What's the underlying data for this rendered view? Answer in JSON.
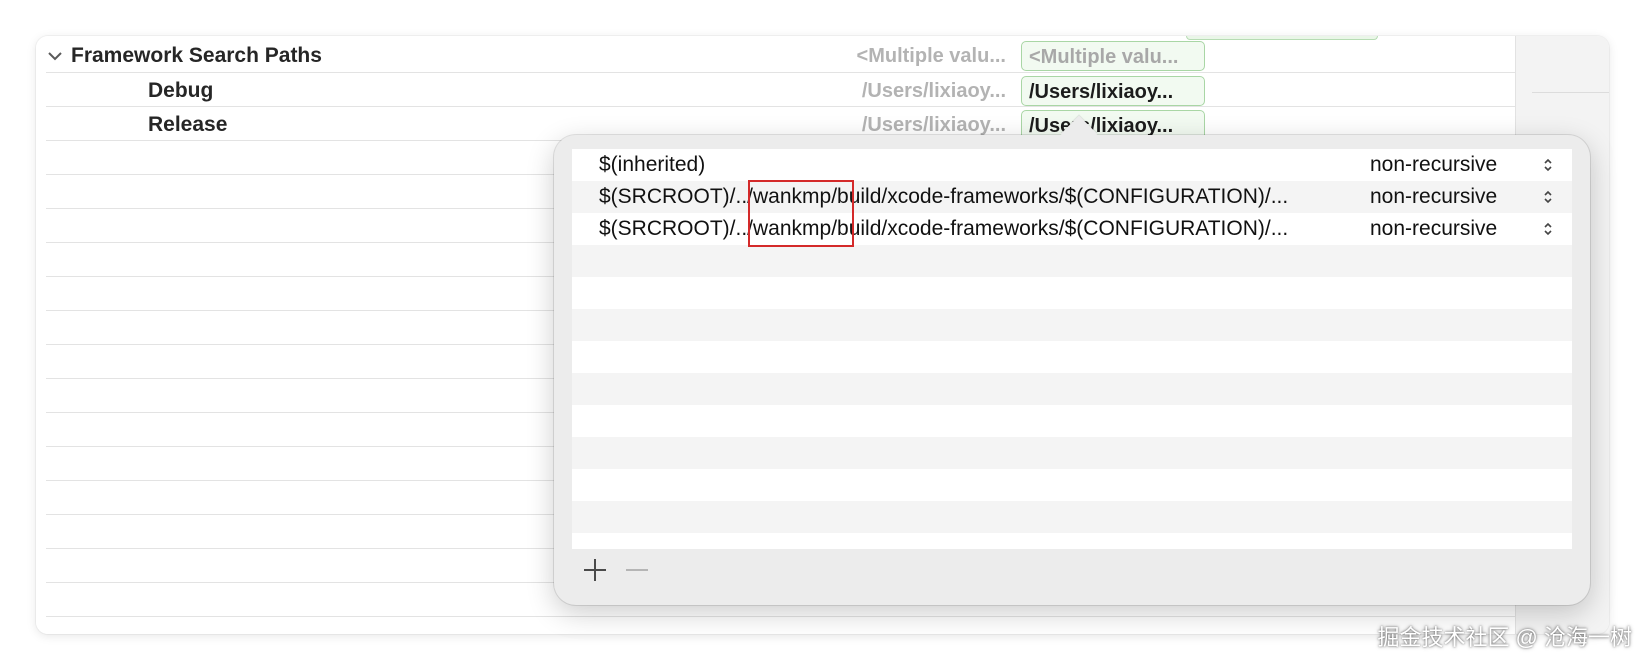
{
  "settings": {
    "rows": [
      {
        "name": "Framework Search Paths",
        "resolved": "<Multiple valu...",
        "target": "<Multiple valu..."
      },
      {
        "name": "Debug",
        "resolved": "/Users/lixiaoy...",
        "target": "/Users/lixiaoy..."
      },
      {
        "name": "Release",
        "resolved": "/Users/lixiaoy...",
        "target": "/Users/lixiaoy..."
      }
    ]
  },
  "popover": {
    "paths": [
      {
        "path": "$(inherited)",
        "recursion": "non-recursive"
      },
      {
        "path": "$(SRCROOT)/../wankmp/build/xcode-frameworks/$(CONFIGURATION)/...",
        "recursion": "non-recursive"
      },
      {
        "path": "$(SRCROOT)/../wankmp/build/xcode-frameworks/$(CONFIGURATION)/...",
        "recursion": "non-recursive"
      }
    ],
    "add_label": "+",
    "remove_label": "−"
  },
  "colors": {
    "highlight_box": "#d42a2a",
    "target_cell_border": "#a9d6a5",
    "target_cell_fill": "#f2faf1"
  },
  "watermark": "掘金技术社区 @ 沧海一树"
}
